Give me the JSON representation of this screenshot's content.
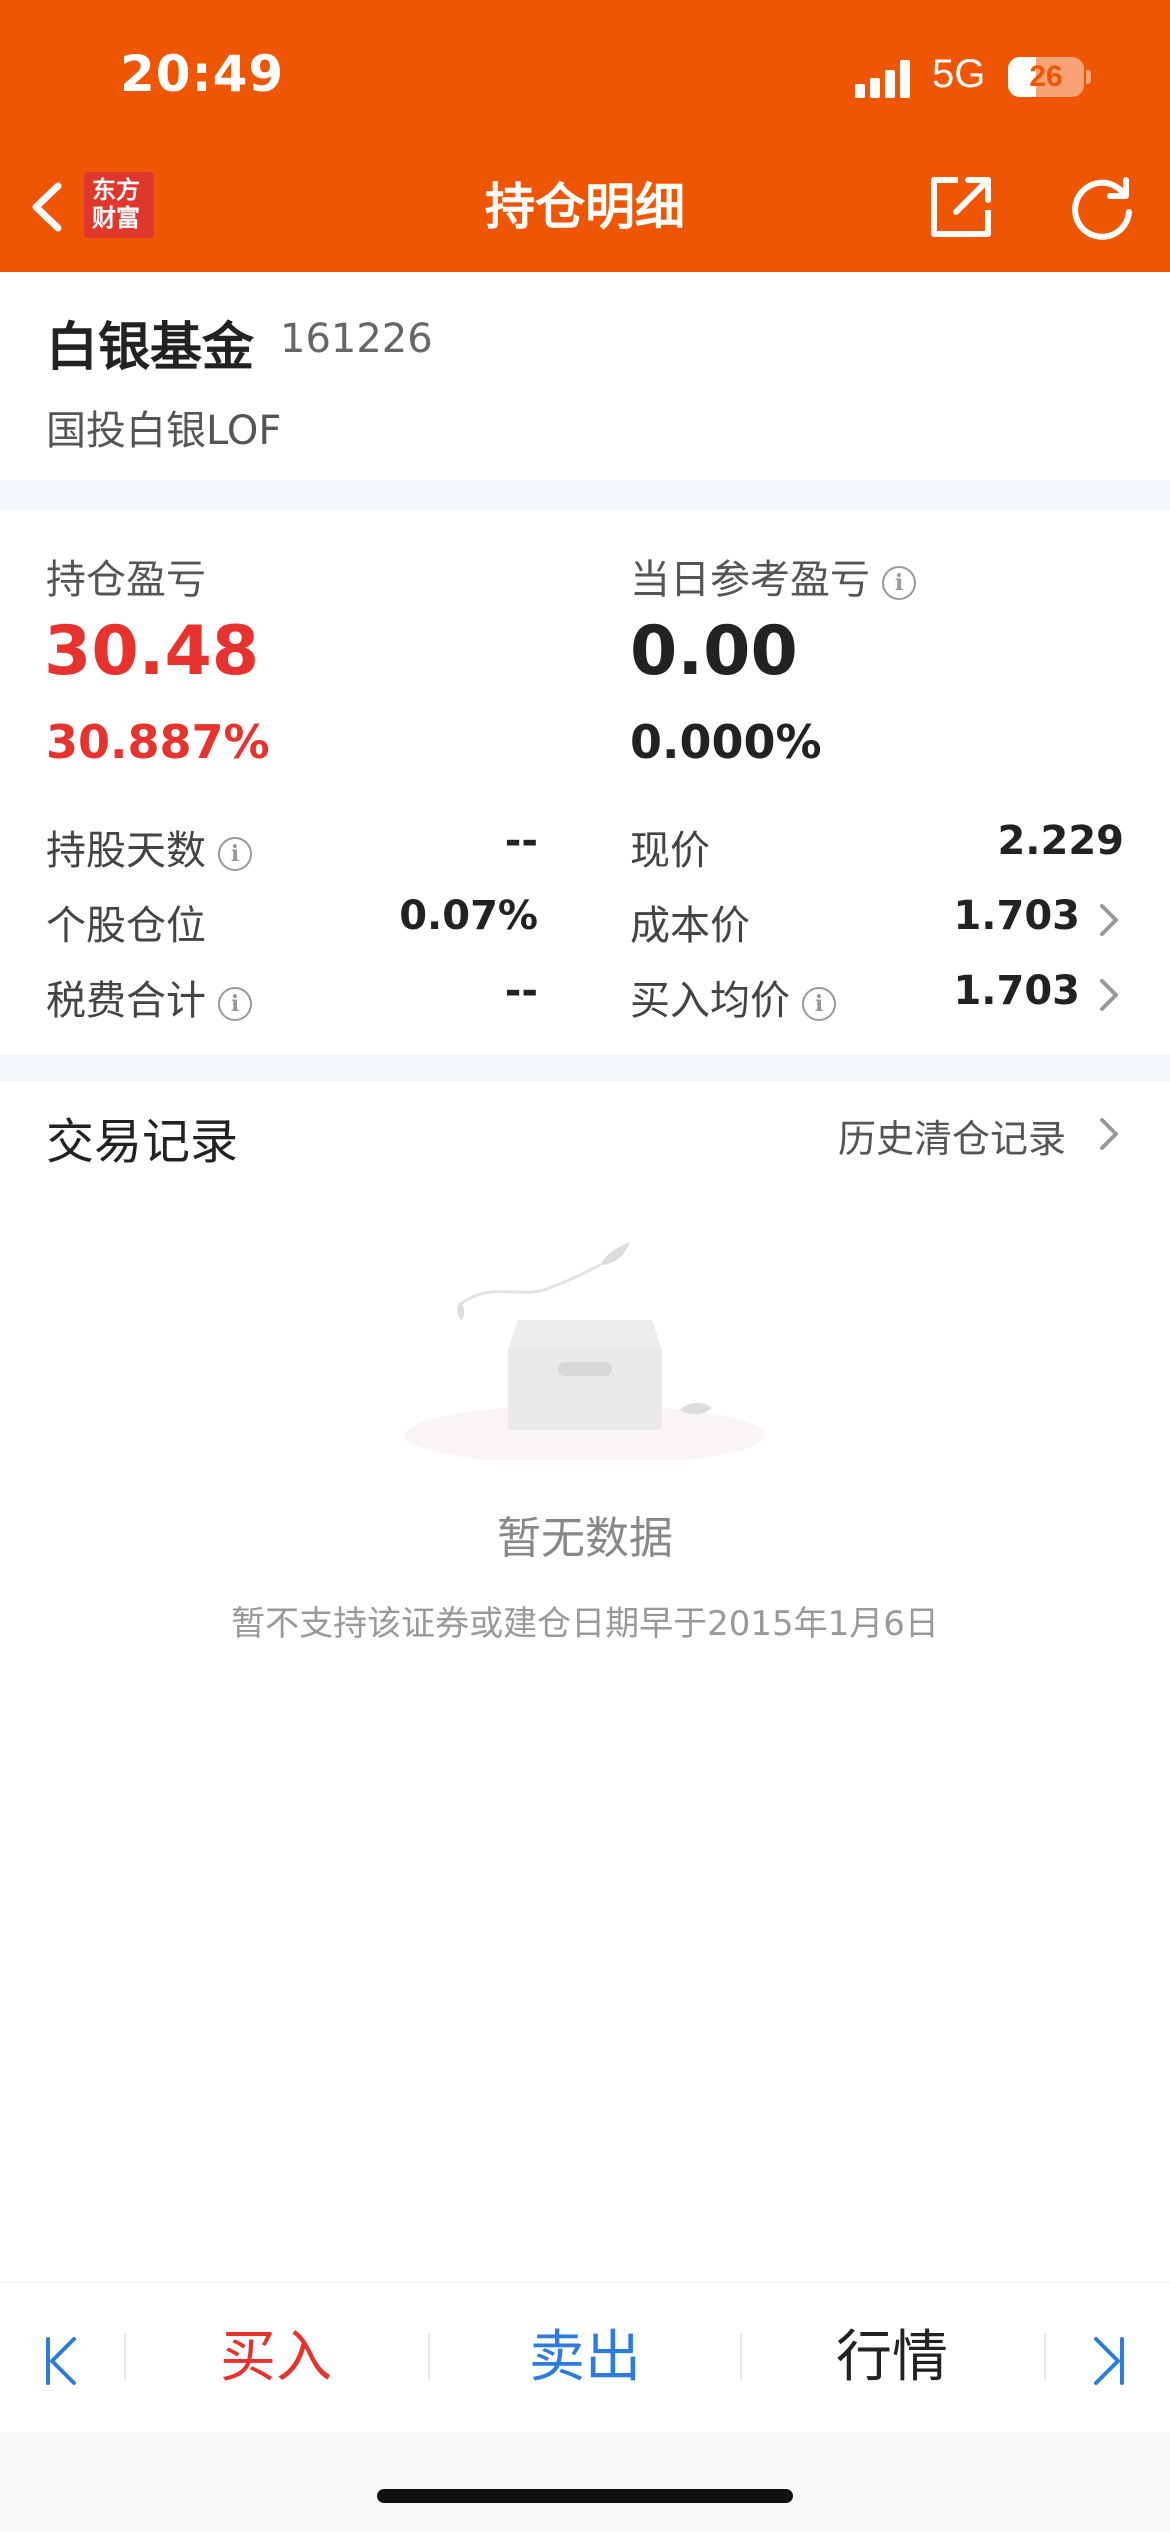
{
  "status_bar": {
    "time": "20:49",
    "network": "5G",
    "battery": "26",
    "battery_level": 0.26
  },
  "nav": {
    "title": "持仓明细",
    "logo_line1": "东方",
    "logo_line2": "财富"
  },
  "fund": {
    "name": "白银基金",
    "code": "161226",
    "full_name": "国投白银LOF"
  },
  "profit": {
    "hold_label": "持仓盈亏",
    "hold_value": "30.48",
    "hold_percent": "30.887%",
    "daily_label": "当日参考盈亏",
    "daily_value": "0.00",
    "daily_percent": "0.000%"
  },
  "details": {
    "days_label": "持股天数",
    "days_value": "--",
    "position_label": "个股仓位",
    "position_value": "0.07%",
    "tax_label": "税费合计",
    "tax_value": "--",
    "price_label": "现价",
    "price_value": "2.229",
    "cost_label": "成本价",
    "cost_value": "1.703",
    "avg_label": "买入均价",
    "avg_value": "1.703"
  },
  "trade": {
    "title": "交易记录",
    "history_link": "历史清仓记录",
    "empty_title": "暂无数据",
    "empty_sub": "暂不支持该证券或建仓日期早于2015年1月6日"
  },
  "bottom_bar": {
    "buy": "买入",
    "sell": "卖出",
    "market": "行情"
  },
  "colors": {
    "brand_orange": "#ef5604",
    "profit_red": "#e8322d",
    "sell_blue": "#2b7be0"
  }
}
